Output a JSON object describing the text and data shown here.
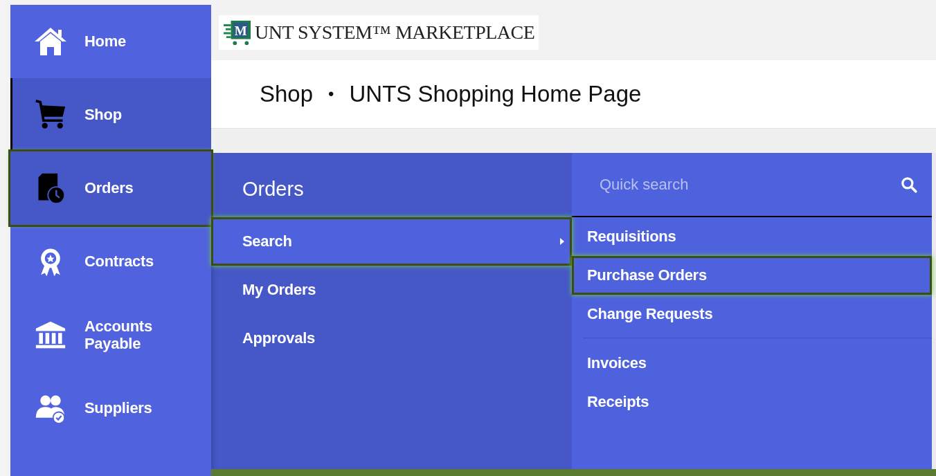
{
  "logo": {
    "letter": "M",
    "text": "UNT SYSTEM™ MARKETPLACE"
  },
  "breadcrumb": {
    "items": [
      "Shop",
      "UNTS Shopping Home Page"
    ],
    "separator": "•"
  },
  "sidebar": {
    "items": [
      {
        "label": "Home",
        "selected": false,
        "expanded": false,
        "highlighted": false
      },
      {
        "label": "Shop",
        "selected": true,
        "expanded": false,
        "highlighted": false
      },
      {
        "label": "Orders",
        "selected": false,
        "expanded": true,
        "highlighted": true
      },
      {
        "label": "Contracts",
        "selected": false,
        "expanded": false,
        "highlighted": false
      },
      {
        "label": "Accounts Payable",
        "selected": false,
        "expanded": false,
        "highlighted": false
      },
      {
        "label": "Suppliers",
        "selected": false,
        "expanded": false,
        "highlighted": false
      }
    ]
  },
  "flyout": {
    "title": "Orders",
    "items": [
      {
        "label": "Search",
        "has_submenu": true,
        "selected": true,
        "highlighted": true
      },
      {
        "label": "My Orders",
        "has_submenu": false,
        "selected": false,
        "highlighted": false
      },
      {
        "label": "Approvals",
        "has_submenu": false,
        "selected": false,
        "highlighted": false
      }
    ]
  },
  "submenu": {
    "search": {
      "placeholder": "Quick search"
    },
    "groups": [
      [
        {
          "label": "Requisitions",
          "highlighted": false
        },
        {
          "label": "Purchase Orders",
          "highlighted": true
        },
        {
          "label": "Change Requests",
          "highlighted": false
        }
      ],
      [
        {
          "label": "Invoices",
          "highlighted": false
        },
        {
          "label": "Receipts",
          "highlighted": false
        }
      ]
    ]
  }
}
